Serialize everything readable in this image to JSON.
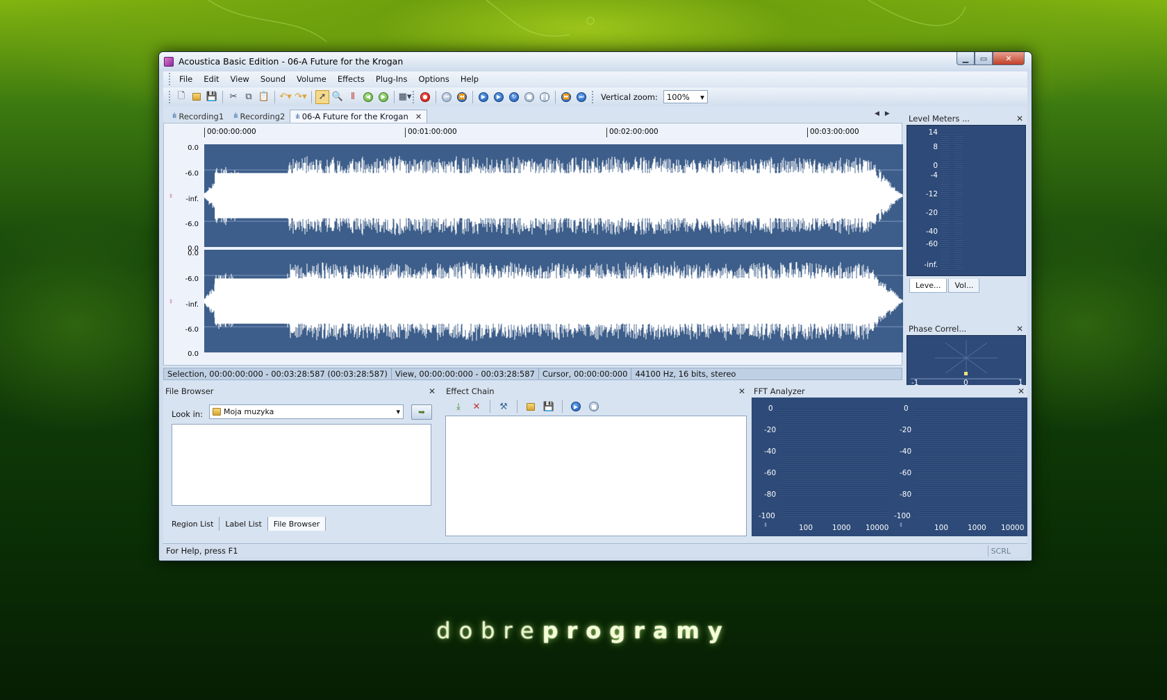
{
  "window": {
    "title": "Acoustica Basic Edition - 06-A Future for the Krogan",
    "min_glyph": "▁",
    "max_glyph": "▭",
    "close_glyph": "✕"
  },
  "menu": [
    "File",
    "Edit",
    "View",
    "Sound",
    "Volume",
    "Effects",
    "Plug-Ins",
    "Options",
    "Help"
  ],
  "toolbar": {
    "vertical_zoom_label": "Vertical zoom:",
    "vertical_zoom_value": "100%"
  },
  "tabs": [
    {
      "label": "Recording1",
      "active": false
    },
    {
      "label": "Recording2",
      "active": false
    },
    {
      "label": "06-A Future for the Krogan",
      "active": true
    }
  ],
  "timeline": [
    "00:00:00:000",
    "00:01:00:000",
    "00:02:00:000",
    "00:03:00:000"
  ],
  "db_scale": {
    "top": [
      "0.0",
      "-6.0",
      "-inf.",
      "-6.0",
      "0.0"
    ],
    "bottom": [
      "0.0",
      "-6.0",
      "-inf.",
      "-6.0",
      "0.0"
    ]
  },
  "wave_status": {
    "selection": "Selection, 00:00:00:000 - 00:03:28:587 (00:03:28:587)",
    "view": "View, 00:00:00:000 - 00:03:28:587",
    "cursor": "Cursor, 00:00:00:000",
    "format": "44100 Hz, 16 bits, stereo"
  },
  "level_meters": {
    "title": "Level Meters ...",
    "scale": [
      "14",
      "8",
      "0",
      "-4",
      "-12",
      "-20",
      "-40",
      "-60",
      "-inf."
    ],
    "tabs": [
      "Leve...",
      "Vol..."
    ]
  },
  "phase": {
    "title": "Phase Correl...",
    "scale": [
      "-1",
      "0",
      "1"
    ]
  },
  "file_browser": {
    "title": "File Browser",
    "look_in_label": "Look in:",
    "look_in_value": "Moja muzyka",
    "tabs": [
      "Region List",
      "Label List",
      "File Browser"
    ]
  },
  "effect_chain": {
    "title": "Effect Chain"
  },
  "fft": {
    "title": "FFT Analyzer",
    "y_scale": [
      "0",
      "-20",
      "-40",
      "-60",
      "-80",
      "-100"
    ],
    "x_scale": [
      "100",
      "1000",
      "10000"
    ]
  },
  "app_status": {
    "help": "For Help, press F1",
    "scrl": "SCRL"
  },
  "brand": {
    "light": "dobre",
    "bold": "programy"
  },
  "colors": {
    "wave_bg": "#3d5e8a",
    "wave_fg": "#ffffff",
    "panel_dark": "#2d4a78"
  }
}
